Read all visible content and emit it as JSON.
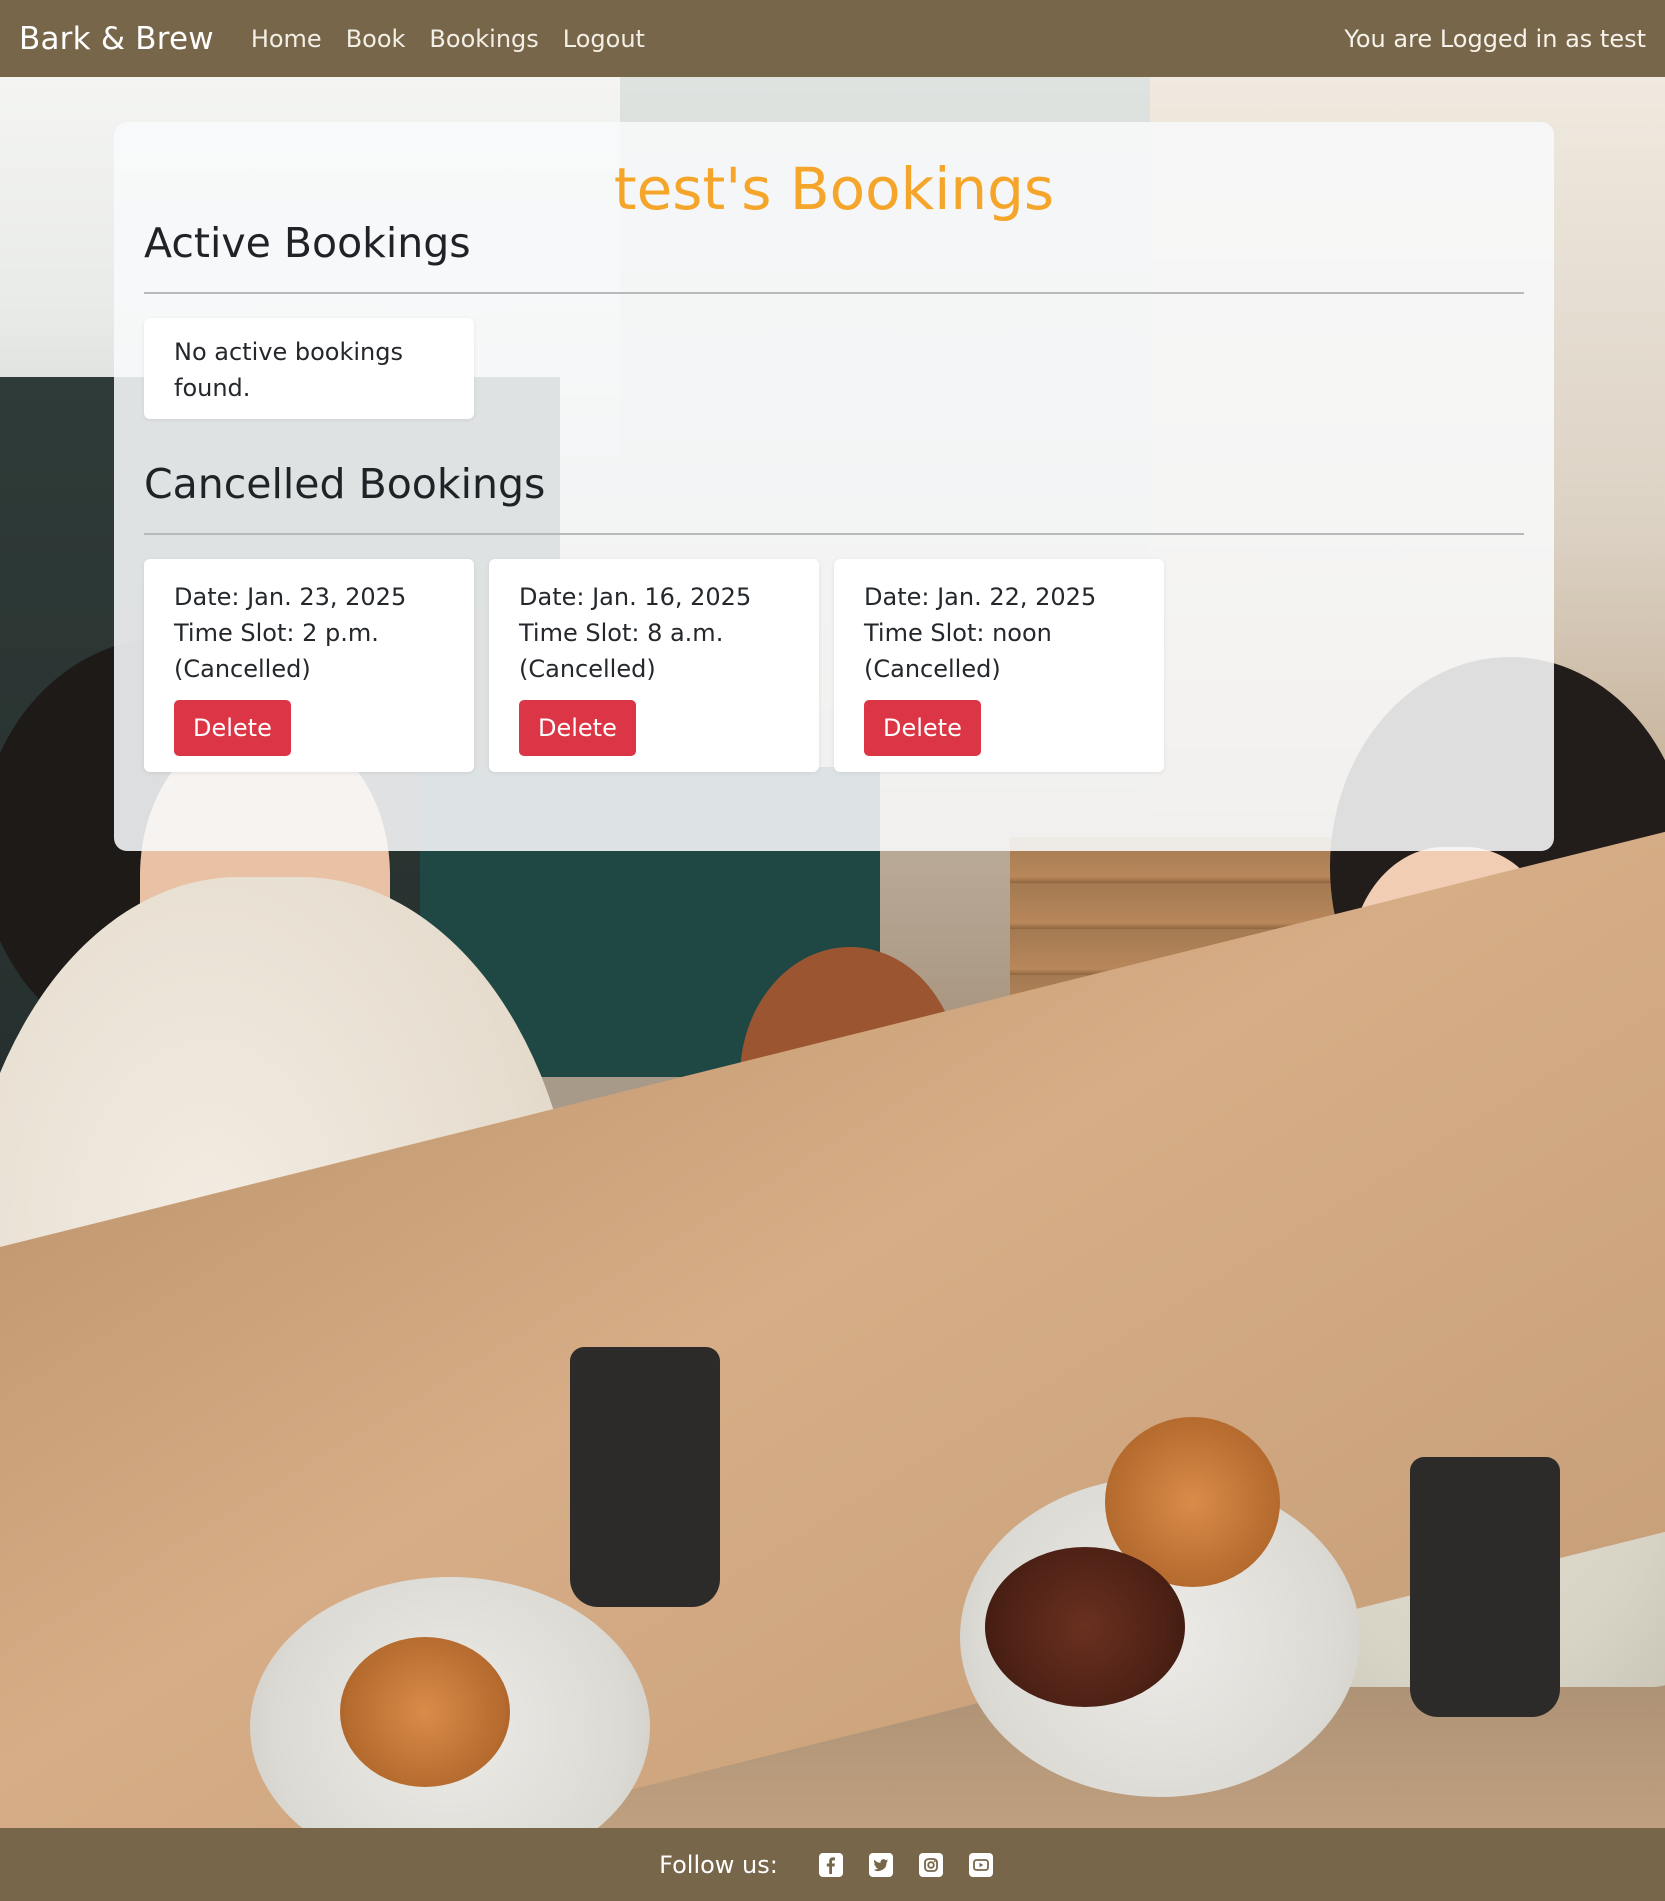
{
  "navbar": {
    "brand": "Bark & Brew",
    "links": [
      {
        "label": "Home"
      },
      {
        "label": "Book"
      },
      {
        "label": "Bookings"
      },
      {
        "label": "Logout"
      }
    ],
    "logged_in_text": "You are Logged in as test"
  },
  "main": {
    "page_title": "test's Bookings",
    "active_section": {
      "title": "Active Bookings",
      "empty_message": "No active bookings found."
    },
    "cancelled_section": {
      "title": "Cancelled Bookings",
      "bookings": [
        {
          "date": "Date: Jan. 23, 2025",
          "time_slot": "Time Slot: 2 p.m.",
          "status": "(Cancelled)",
          "delete_label": "Delete"
        },
        {
          "date": "Date: Jan. 16, 2025",
          "time_slot": "Time Slot: 8 a.m.",
          "status": "(Cancelled)",
          "delete_label": "Delete"
        },
        {
          "date": "Date: Jan. 22, 2025",
          "time_slot": "Time Slot: noon",
          "status": "(Cancelled)",
          "delete_label": "Delete"
        }
      ]
    }
  },
  "footer": {
    "follow_label": "Follow us:",
    "social_icons": [
      "facebook-icon",
      "twitter-icon",
      "instagram-icon",
      "youtube-icon"
    ]
  },
  "colors": {
    "navbar_bg": "#77664a",
    "title_accent": "#f5a52a",
    "delete_button": "#dc3545"
  }
}
